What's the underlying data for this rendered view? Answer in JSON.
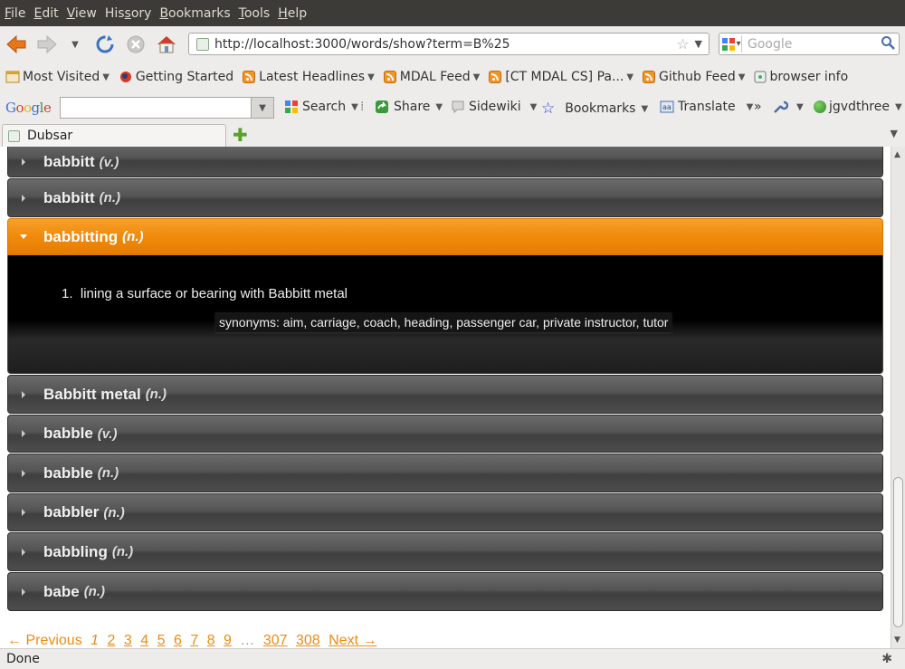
{
  "menu": [
    "File",
    "Edit",
    "View",
    "History",
    "Bookmarks",
    "Tools",
    "Help"
  ],
  "menu_accel": [
    "F",
    "E",
    "V",
    "s",
    "B",
    "T",
    "H"
  ],
  "nav": {
    "url": "http://localhost:3000/words/show?term=B%25",
    "search_placeholder": "Google"
  },
  "bookmarks": [
    {
      "label": "Most Visited",
      "icon": "most-visited-icon",
      "arrow": true
    },
    {
      "label": "Getting Started",
      "icon": "firefox-icon",
      "arrow": false
    },
    {
      "label": "Latest Headlines",
      "icon": "rss-icon",
      "arrow": true
    },
    {
      "label": "MDAL Feed",
      "icon": "rss-icon",
      "arrow": true
    },
    {
      "label": "[CT MDAL CS] Pa...",
      "icon": "rss-icon",
      "arrow": true
    },
    {
      "label": "Github Feed",
      "icon": "rss-icon",
      "arrow": true
    },
    {
      "label": "browser info",
      "icon": "page-icon",
      "arrow": false
    }
  ],
  "googlebar": {
    "logo": "Google",
    "search": "Search",
    "share": "Share",
    "sidewiki": "Sidewiki",
    "bookmarks": "Bookmarks",
    "translate": "Translate",
    "more": "»",
    "user": "jgvdthree"
  },
  "tab": {
    "title": "Dubsar"
  },
  "entries": [
    {
      "word": "babbitt",
      "pos": "(v.)"
    },
    {
      "word": "babbitt",
      "pos": "(n.)"
    },
    {
      "word": "babbitting",
      "pos": "(n.)"
    },
    {
      "word": "Babbitt metal",
      "pos": "(n.)"
    },
    {
      "word": "babble",
      "pos": "(v.)"
    },
    {
      "word": "babble",
      "pos": "(n.)"
    },
    {
      "word": "babbler",
      "pos": "(n.)"
    },
    {
      "word": "babbling",
      "pos": "(n.)"
    },
    {
      "word": "babe",
      "pos": "(n.)"
    }
  ],
  "active_entry": {
    "definition_number": "1.",
    "definition": "lining a surface or bearing with Babbitt metal",
    "synonyms": "synonyms: aim, carriage, coach, heading, passenger car, private instructor, tutor"
  },
  "pager": {
    "previous": "← Previous",
    "current": "1",
    "pages": [
      "2",
      "3",
      "4",
      "5",
      "6",
      "7",
      "8",
      "9"
    ],
    "gap": "…",
    "last_pages": [
      "307",
      "308"
    ],
    "next": "Next →"
  },
  "status": {
    "text": "Done"
  },
  "colors": {
    "accent": "#f08a0c",
    "row_dark": "#4d4d4d",
    "menubar": "#3c3b37"
  }
}
